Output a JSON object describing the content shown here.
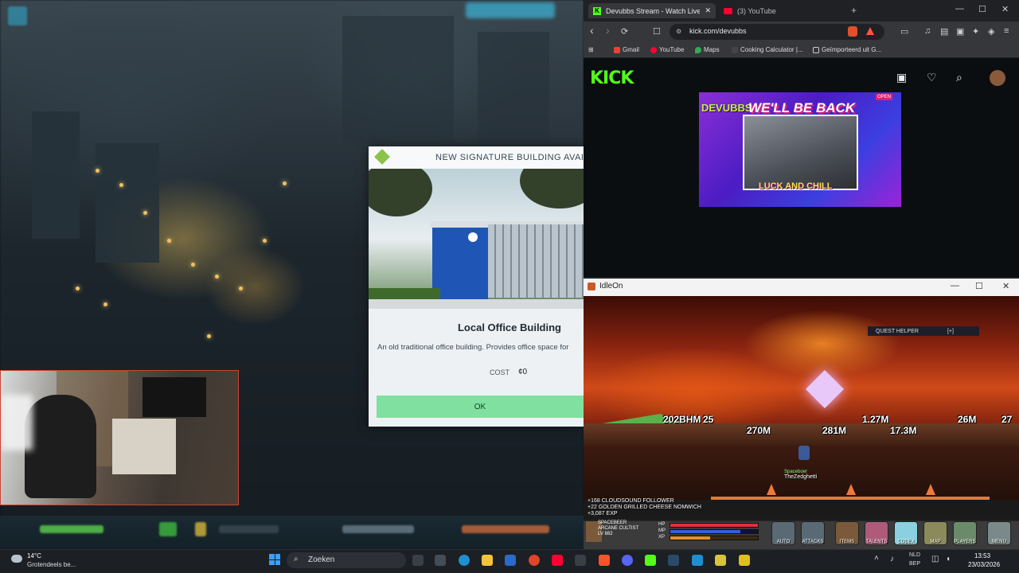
{
  "modal": {
    "header": "NEW SIGNATURE BUILDING AVAILABLE",
    "title": "Local Office Building",
    "description": "An old traditional office building. Provides office space for",
    "cost_label": "COST",
    "cost_value": "¢0",
    "ok_label": "OK"
  },
  "browser": {
    "tabs": [
      {
        "label": "Devubbs Stream - Watch Live",
        "close": "✕"
      },
      {
        "label": "(3) YouTube",
        "close": "✕"
      }
    ],
    "new_tab": "+",
    "window_controls": {
      "minimize": "—",
      "maximize": "☐",
      "close": "✕"
    },
    "url": "kick.com/devubbs",
    "bookmarks": [
      "Gmail",
      "YouTube",
      "Maps",
      "Cooking Calculator |...",
      "Geïmporteerd uit G..."
    ],
    "icons": {
      "back": "‹",
      "forward": "›",
      "reload": "⟳",
      "bookmark": "☐",
      "apps": "⊞"
    }
  },
  "kick": {
    "logo": "KICK",
    "stream": {
      "brand": "DEVUBBS",
      "title": "WE'LL BE BACK",
      "subtitle": "LUCK AND CHILL",
      "badge": "OPEN"
    }
  },
  "idleon": {
    "title": "IdleOn",
    "window_controls": {
      "minimize": "—",
      "maximize": "☐",
      "close": "✕"
    },
    "quest_helper": "QUEST HELPER",
    "quest_helper_toggle": "[+]",
    "damage_numbers": [
      "202BHM",
      "25",
      "1.27M",
      "270M",
      "281M",
      "17.3M",
      "26M",
      "27"
    ],
    "player_name": "TheZedghetti",
    "player_tag": "Spaceboer",
    "feed": [
      "+168 CLOUDSOUND FOLLOWER",
      "+22 GOLDEN GRILLED CHEESE NOMWICH",
      "+3,087 EXP"
    ],
    "character": {
      "name": "SPACEBEER",
      "class": "ARCANE CULTIST",
      "level": "LV 882"
    },
    "stats": {
      "hp_label": "HP",
      "mp_label": "MP",
      "xp_label": "XP",
      "hp_fill": 1.0,
      "mp_fill": 0.8,
      "xp_fill": 0.45
    },
    "hud_buttons": [
      "AUTO",
      "ATTACKS",
      "ITEMS",
      "TALENTS",
      "CODEX",
      "MAP",
      "PLAYERS",
      "MENU"
    ]
  },
  "taskbar": {
    "weather_temp": "14°C",
    "weather_desc": "Grotendeels be...",
    "search_placeholder": "Zoeken",
    "lang_1": "NLD",
    "lang_2": "BEP",
    "time": "13:53",
    "date": "23/03/2026"
  },
  "colors": {
    "kick_green": "#53fc18",
    "ok_button": "#7fe0a0",
    "youtube_red": "#ff0033"
  }
}
